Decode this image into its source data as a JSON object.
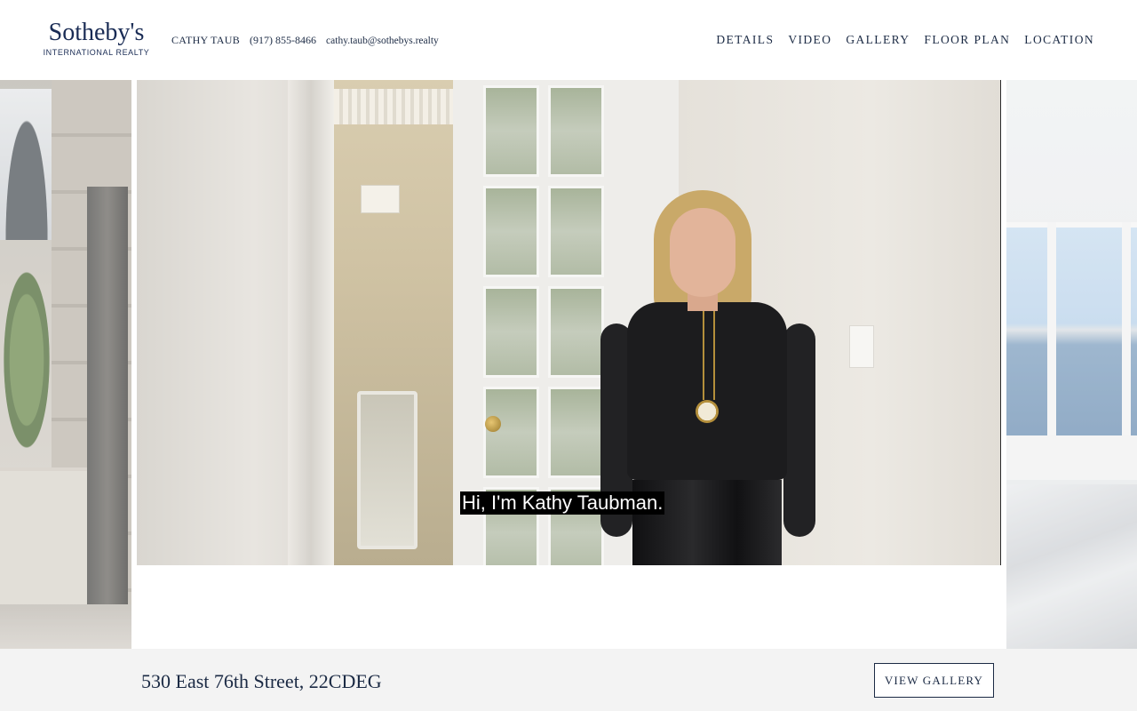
{
  "brand": {
    "logo_text": "Sotheby's",
    "logo_subtext": "INTERNATIONAL REALTY"
  },
  "contact": {
    "name": "CATHY TAUB",
    "phone": "(917) 855-8466",
    "email": "cathy.taub@sothebys.realty"
  },
  "nav": {
    "items": [
      {
        "label": "DETAILS"
      },
      {
        "label": "VIDEO"
      },
      {
        "label": "GALLERY"
      },
      {
        "label": "FLOOR PLAN"
      },
      {
        "label": "LOCATION"
      }
    ]
  },
  "video": {
    "caption": "Hi, I'm Kathy Taubman."
  },
  "listing": {
    "address": "530 East 76th Street, 22CDEG",
    "view_gallery_label": "VIEW GALLERY"
  },
  "colors": {
    "brand_navy": "#1a2c55",
    "text": "#1b2a44",
    "bottom_bar": "#f3f3f3"
  }
}
